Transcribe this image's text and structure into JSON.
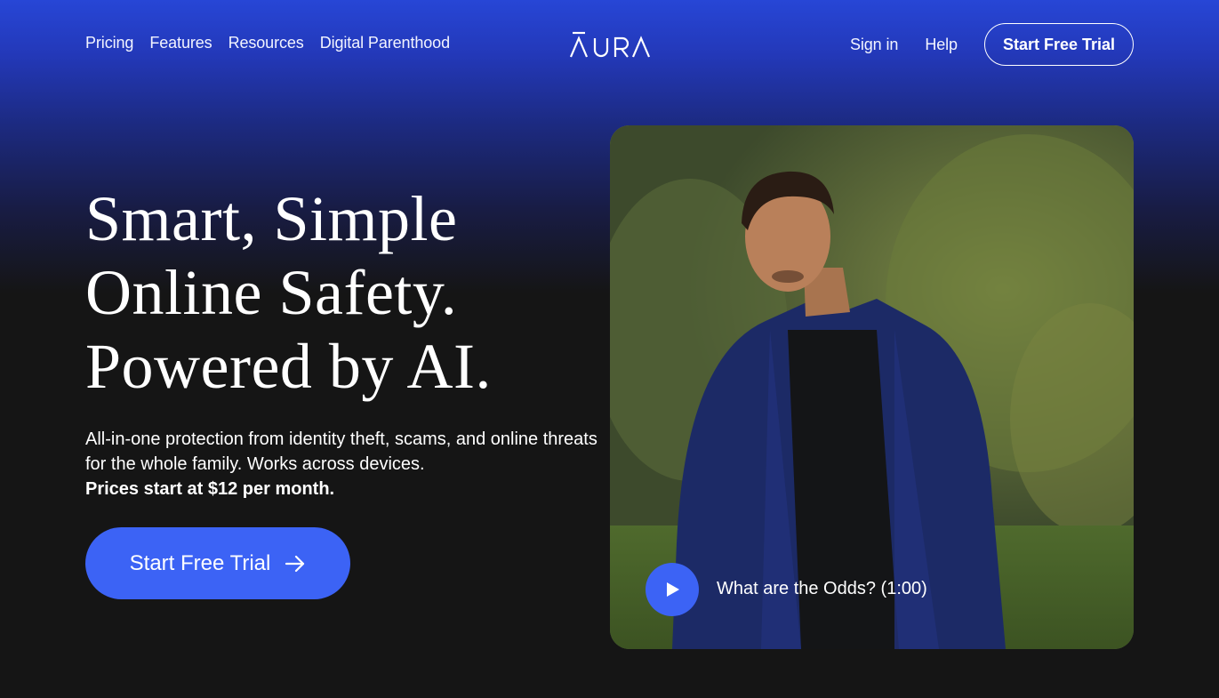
{
  "nav": {
    "left_links": [
      "Pricing",
      "Features",
      "Resources",
      "Digital Parenthood"
    ],
    "logo": "ĀURA",
    "signin": "Sign in",
    "help": "Help",
    "cta": "Start Free Trial"
  },
  "hero": {
    "title_line1": "Smart, Simple",
    "title_line2": "Online Safety.",
    "title_line3": "Powered by AI.",
    "subtitle": "All-in-one protection from identity theft, scams, and online threats for the whole family. Works across devices.",
    "price_note": "Prices start at $12 per month.",
    "cta": "Start Free Trial",
    "cta_icon": "arrow-right-icon"
  },
  "video": {
    "caption": "What are the Odds? (1:00)",
    "play_icon": "play-icon"
  },
  "colors": {
    "accent": "#3c63f5",
    "bg_dark": "#151515",
    "bg_top": "#2746d6"
  }
}
